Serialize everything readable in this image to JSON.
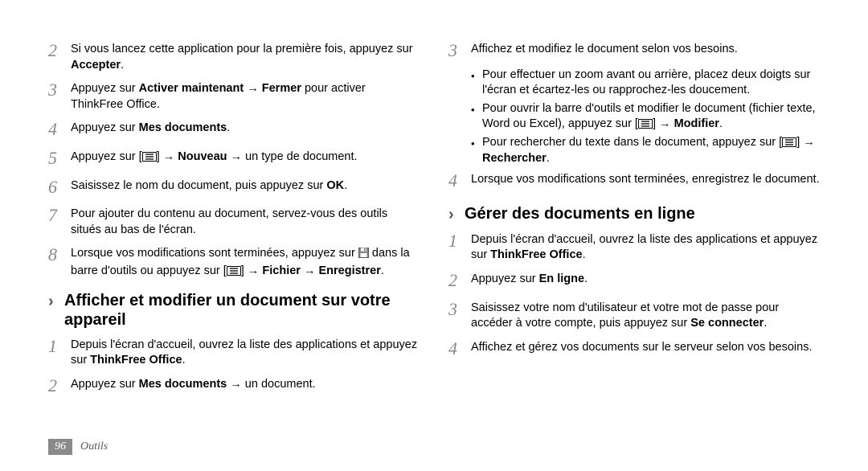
{
  "footer": {
    "page_number": "96",
    "section": "Outils"
  },
  "left": {
    "steps": [
      {
        "n": "2",
        "parts": [
          {
            "t": "Si vous lancez cette application pour la première fois, appuyez sur "
          },
          {
            "t": "Accepter",
            "b": true
          },
          {
            "t": "."
          }
        ]
      },
      {
        "n": "3",
        "parts": [
          {
            "t": "Appuyez sur "
          },
          {
            "t": "Activer maintenant",
            "b": true
          },
          {
            "t": " → "
          },
          {
            "t": "Fermer",
            "b": true
          },
          {
            "t": " pour activer ThinkFree Office."
          }
        ]
      },
      {
        "n": "4",
        "parts": [
          {
            "t": "Appuyez sur "
          },
          {
            "t": "Mes documents",
            "b": true
          },
          {
            "t": "."
          }
        ]
      },
      {
        "n": "5",
        "parts": [
          {
            "t": "Appuyez sur ["
          },
          {
            "icon": "menu"
          },
          {
            "t": "] → "
          },
          {
            "t": "Nouveau",
            "b": true
          },
          {
            "t": " → un type de document."
          }
        ]
      },
      {
        "n": "6",
        "parts": [
          {
            "t": "Saisissez le nom du document, puis appuyez sur "
          },
          {
            "t": "OK",
            "b": true
          },
          {
            "t": "."
          }
        ]
      },
      {
        "n": "7",
        "parts": [
          {
            "t": "Pour ajouter du contenu au document, servez-vous des outils situés au bas de l'écran."
          }
        ]
      },
      {
        "n": "8",
        "parts": [
          {
            "t": "Lorsque vos modifications sont terminées, appuyez sur "
          },
          {
            "icon": "save"
          },
          {
            "t": " dans la barre d'outils ou appuyez sur ["
          },
          {
            "icon": "menu"
          },
          {
            "t": "] → "
          },
          {
            "t": "Fichier",
            "b": true
          },
          {
            "t": " → "
          },
          {
            "t": "Enregistrer",
            "b": true
          },
          {
            "t": "."
          }
        ]
      }
    ],
    "section_title": "Afficher et modifier un document sur votre appareil",
    "sub_steps": [
      {
        "n": "1",
        "parts": [
          {
            "t": "Depuis l'écran d'accueil, ouvrez la liste des applications et appuyez sur "
          },
          {
            "t": "ThinkFree Office",
            "b": true
          },
          {
            "t": "."
          }
        ]
      },
      {
        "n": "2",
        "parts": [
          {
            "t": "Appuyez sur "
          },
          {
            "t": "Mes documents",
            "b": true
          },
          {
            "t": " → un document."
          }
        ]
      }
    ]
  },
  "right": {
    "steps_a": [
      {
        "n": "3",
        "parts": [
          {
            "t": "Affichez et modifiez le document selon vos besoins."
          }
        ]
      }
    ],
    "bullets": [
      {
        "parts": [
          {
            "t": "Pour effectuer un zoom avant ou arrière, placez deux doigts sur l'écran et écartez-les ou rapprochez-les doucement."
          }
        ]
      },
      {
        "parts": [
          {
            "t": "Pour ouvrir la barre d'outils et modifier le document (fichier texte, Word ou Excel), appuyez sur ["
          },
          {
            "icon": "menu"
          },
          {
            "t": "] → "
          },
          {
            "t": "Modifier",
            "b": true
          },
          {
            "t": "."
          }
        ]
      },
      {
        "parts": [
          {
            "t": "Pour rechercher du texte dans le document, appuyez sur ["
          },
          {
            "icon": "menu"
          },
          {
            "t": "] → "
          },
          {
            "t": "Rechercher",
            "b": true
          },
          {
            "t": "."
          }
        ]
      }
    ],
    "steps_b": [
      {
        "n": "4",
        "parts": [
          {
            "t": "Lorsque vos modifications sont terminées, enregistrez le document."
          }
        ]
      }
    ],
    "section_title": "Gérer des documents en ligne",
    "sub_steps": [
      {
        "n": "1",
        "parts": [
          {
            "t": "Depuis l'écran d'accueil, ouvrez la liste des applications et appuyez sur "
          },
          {
            "t": "ThinkFree Office",
            "b": true
          },
          {
            "t": "."
          }
        ]
      },
      {
        "n": "2",
        "parts": [
          {
            "t": "Appuyez sur "
          },
          {
            "t": "En ligne",
            "b": true
          },
          {
            "t": "."
          }
        ]
      },
      {
        "n": "3",
        "parts": [
          {
            "t": "Saisissez votre nom d'utilisateur et votre mot de passe pour accéder à votre compte, puis appuyez sur "
          },
          {
            "t": "Se connecter",
            "b": true
          },
          {
            "t": "."
          }
        ]
      },
      {
        "n": "4",
        "parts": [
          {
            "t": "Affichez et gérez vos documents sur le serveur selon vos besoins."
          }
        ]
      }
    ]
  }
}
